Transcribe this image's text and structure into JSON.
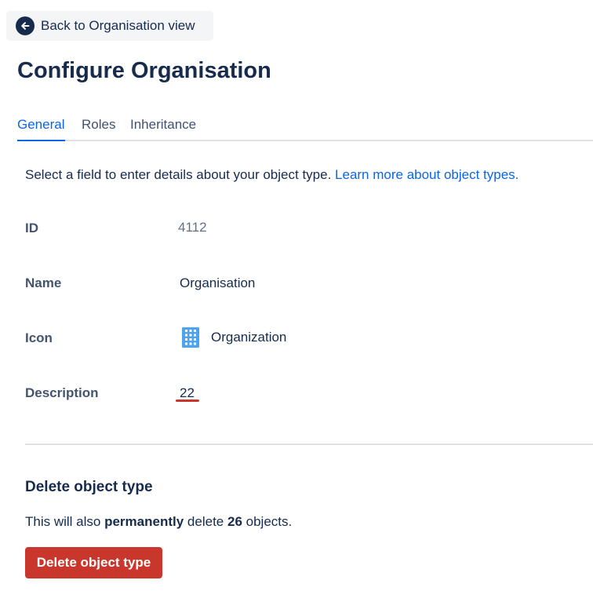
{
  "back_link": {
    "label": "Back to Organisation view",
    "icon": "arrow-left-circle-icon"
  },
  "page": {
    "title": "Configure Organisation"
  },
  "tabs": [
    {
      "label": "General",
      "active": true
    },
    {
      "label": "Roles",
      "active": false
    },
    {
      "label": "Inheritance",
      "active": false
    }
  ],
  "intro": {
    "text": "Select a field to enter details about your object type.",
    "link": "Learn more about object types."
  },
  "fields": {
    "id": {
      "label": "ID",
      "value": "4112"
    },
    "name": {
      "label": "Name",
      "value": "Organisation"
    },
    "icon": {
      "label": "Icon",
      "value": "Organization",
      "icon": "building-icon"
    },
    "description": {
      "label": "Description",
      "value": "22"
    }
  },
  "delete_section": {
    "title": "Delete object type",
    "text_before": "This will also",
    "text_bold": "permanently",
    "text_middle": "delete",
    "count": "26",
    "text_after": "objects.",
    "button_label": "Delete object type"
  },
  "colors": {
    "accent": "#0c66e4",
    "danger": "#c9372c",
    "text": "#172b4d"
  }
}
